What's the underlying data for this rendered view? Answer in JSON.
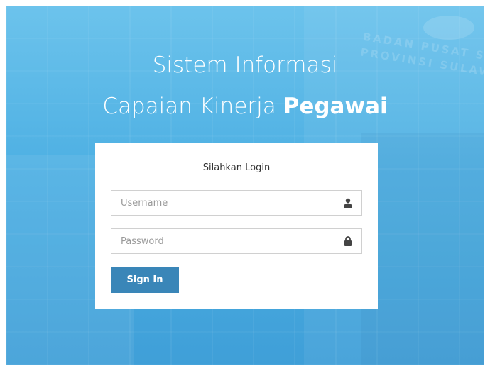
{
  "header": {
    "line1": "Sistem Informasi",
    "line2_regular": "Capaian Kinerja",
    "line2_bold": "Pegawai"
  },
  "background": {
    "sign_line1": "BADAN PUSAT S",
    "sign_line2": "PROVINSI SULAWESI"
  },
  "login": {
    "title": "Silahkan Login",
    "username": {
      "placeholder": "Username",
      "value": "",
      "icon": "user-icon"
    },
    "password": {
      "placeholder": "Password",
      "value": "",
      "icon": "lock-icon"
    },
    "submit_label": "Sign In"
  },
  "colors": {
    "background": "#4eb0e3",
    "button": "#3a86b8",
    "card": "#ffffff"
  }
}
